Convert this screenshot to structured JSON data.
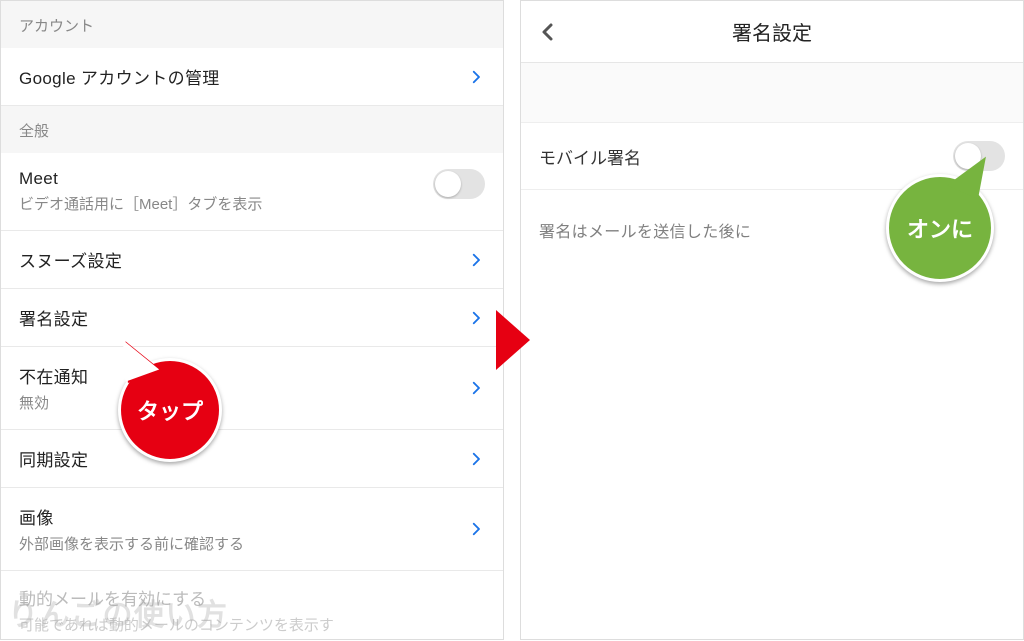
{
  "left": {
    "section_account": "アカウント",
    "manage_google": "Google アカウントの管理",
    "section_general": "全般",
    "meet_title": "Meet",
    "meet_sub": "ビデオ通話用に［Meet］タブを表示",
    "snooze": "スヌーズ設定",
    "signature": "署名設定",
    "vacation_title": "不在通知",
    "vacation_sub": "無効",
    "sync": "同期設定",
    "images_title": "画像",
    "images_sub": "外部画像を表示する前に確認する",
    "dynamic_title": "動的メールを有効にする",
    "dynamic_sub": "可能であれば動的メールのコンテンツを表示す"
  },
  "right": {
    "nav_title": "署名設定",
    "mobile_sig": "モバイル署名",
    "desc": "署名はメールを送信した後に"
  },
  "callouts": {
    "tap": "タップ",
    "turn_on": "オンに"
  },
  "watermark": "りんごの使い方"
}
